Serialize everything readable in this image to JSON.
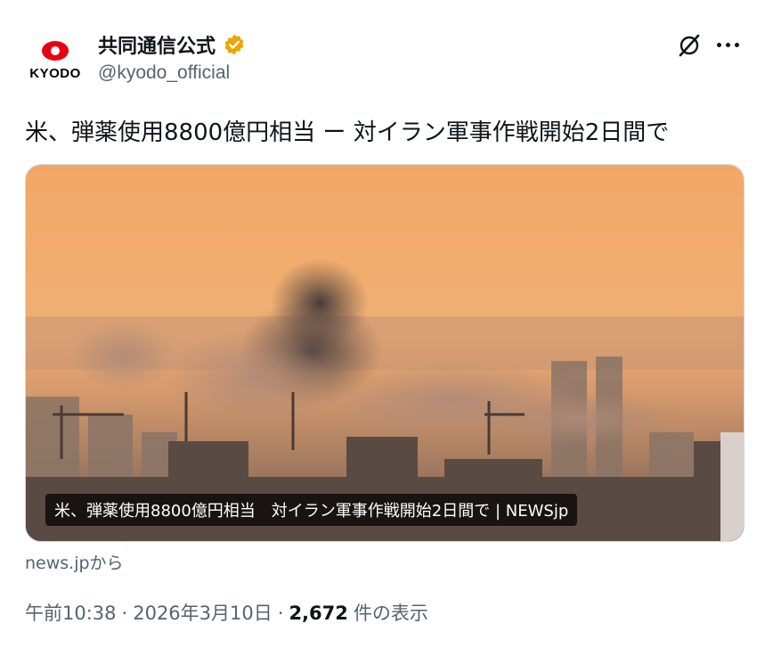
{
  "author": {
    "display_name": "共同通信公式",
    "handle": "@kyodo_official",
    "avatar_text": "KYODO",
    "verified_color": "#e8a800"
  },
  "tweet": {
    "text": "米、弾薬使用8800億円相当 ー 対イラン軍事作戦開始2日間で"
  },
  "card": {
    "caption": "米、弾薬使用8800億円相当　対イラン軍事作戦開始2日間で | NEWSjp",
    "source": "news.jpから",
    "image_description_icon": "city-smoke-photo"
  },
  "meta": {
    "time": "午前10:38",
    "sep1": "·",
    "date": "2026年3月10日",
    "sep2": "·",
    "views_count": "2,672",
    "views_label": "件の表示"
  },
  "icons": {
    "grok": "grok-icon",
    "more": "more-icon"
  }
}
